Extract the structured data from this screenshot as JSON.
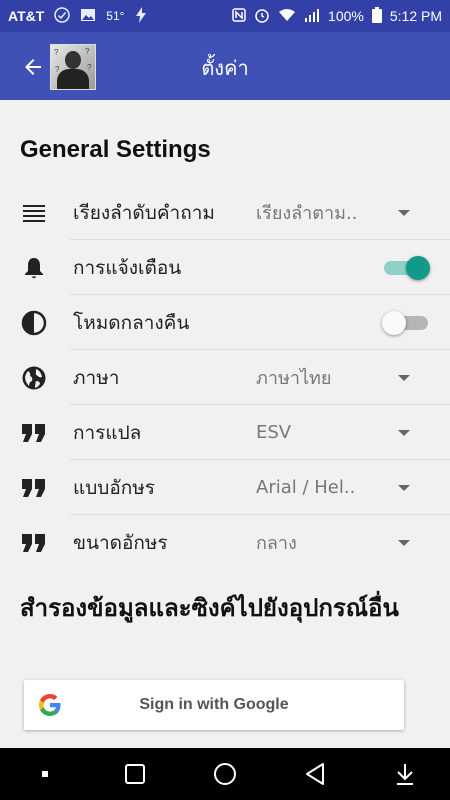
{
  "status_bar": {
    "carrier": "AT&T",
    "temperature": "51°",
    "battery": "100%",
    "time": "5:12 PM"
  },
  "app_bar": {
    "title": "ตั้งค่า",
    "back_icon": "arrow-back-icon"
  },
  "general": {
    "title": "General Settings",
    "rows": [
      {
        "icon": "sort-lines-icon",
        "label": "เรียงลำดับคำถาม",
        "type": "dropdown",
        "value": "เรียงลำตาม.."
      },
      {
        "icon": "bell-icon",
        "label": "การแจ้งเตือน",
        "type": "toggle",
        "on": true
      },
      {
        "icon": "contrast-icon",
        "label": "โหมดกลางคืน",
        "type": "toggle",
        "on": false
      },
      {
        "icon": "globe-icon",
        "label": "ภาษา",
        "type": "dropdown",
        "value": "ภาษาไทย"
      },
      {
        "icon": "quote-icon",
        "label": "การแปล",
        "type": "dropdown",
        "value": "ESV"
      },
      {
        "icon": "quote-icon",
        "label": "แบบอักษร",
        "type": "dropdown",
        "value": "Arial / Hel.."
      },
      {
        "icon": "quote-icon",
        "label": "ขนาดอักษร",
        "type": "dropdown",
        "value": "กลาง"
      }
    ]
  },
  "backup": {
    "title": "สำรองข้อมูลและซิงค์ไปยังอุปกรณ์อื่น",
    "google_button": "Sign in with Google"
  },
  "colors": {
    "status_bar": "#3240a8",
    "app_bar": "#3f51b5",
    "toggle_on_thumb": "#119a8a",
    "toggle_on_track": "#8fd1c9",
    "toggle_off_thumb": "#fafafa",
    "toggle_off_track": "#b5b5b5"
  }
}
